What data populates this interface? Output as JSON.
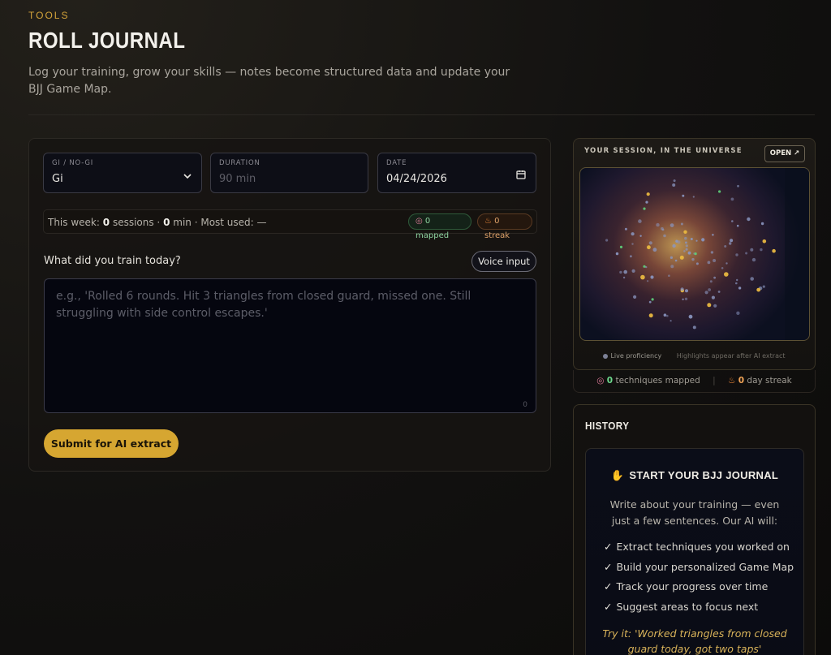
{
  "header": {
    "eyebrow": "TOOLS",
    "title": "ROLL JOURNAL",
    "subtitle": "Log your training, grow your skills — notes become structured data and update your BJJ Game Map."
  },
  "form": {
    "gi": {
      "label": "GI / NO-GI",
      "value": "Gi",
      "icon": "chevron-down-icon"
    },
    "duration": {
      "label": "DURATION",
      "placeholder": "90 min"
    },
    "date": {
      "label": "DATE",
      "value": "04/24/2026",
      "icon": "calendar-icon"
    },
    "stats": {
      "prefix": "This week:",
      "sessions_count": "0",
      "sessions_label": "sessions ·",
      "minutes_count": "0",
      "minutes_label": "min · Most used:",
      "most_used": "—",
      "mapped_pill": "0 mapped",
      "streak_pill": "0 streak"
    },
    "question": "What did you train today?",
    "voice_button": "Voice input",
    "textarea_placeholder": "e.g., 'Rolled 6 rounds. Hit 3 triangles from closed guard, missed one. Still struggling with side control escapes.'",
    "char_count": "0",
    "submit_button": "Submit for AI extract"
  },
  "universe": {
    "title": "YOUR SESSION, IN THE UNIVERSE",
    "open_button": "OPEN ↗",
    "legend_live": "Live proficiency",
    "legend_note": "Highlights appear after AI extract",
    "techniques_count": "0",
    "techniques_label": "techniques mapped",
    "streak_count": "0",
    "streak_label": "day streak",
    "colors": {
      "gold": "#e8b740",
      "green": "#5fd07a",
      "blue": "#8a96c0"
    }
  },
  "history": {
    "title": "HISTORY",
    "journal_heading": "START YOUR BJJ JOURNAL",
    "journal_icon": "waving-hand-icon",
    "intro": "Write about your training — even just a few sentences. Our AI will:",
    "features": [
      "Extract techniques you worked on",
      "Build your personalized Game Map",
      "Track your progress over time",
      "Suggest areas to focus next"
    ],
    "try_it": "Try it: 'Worked triangles from closed guard today, got two taps'"
  }
}
